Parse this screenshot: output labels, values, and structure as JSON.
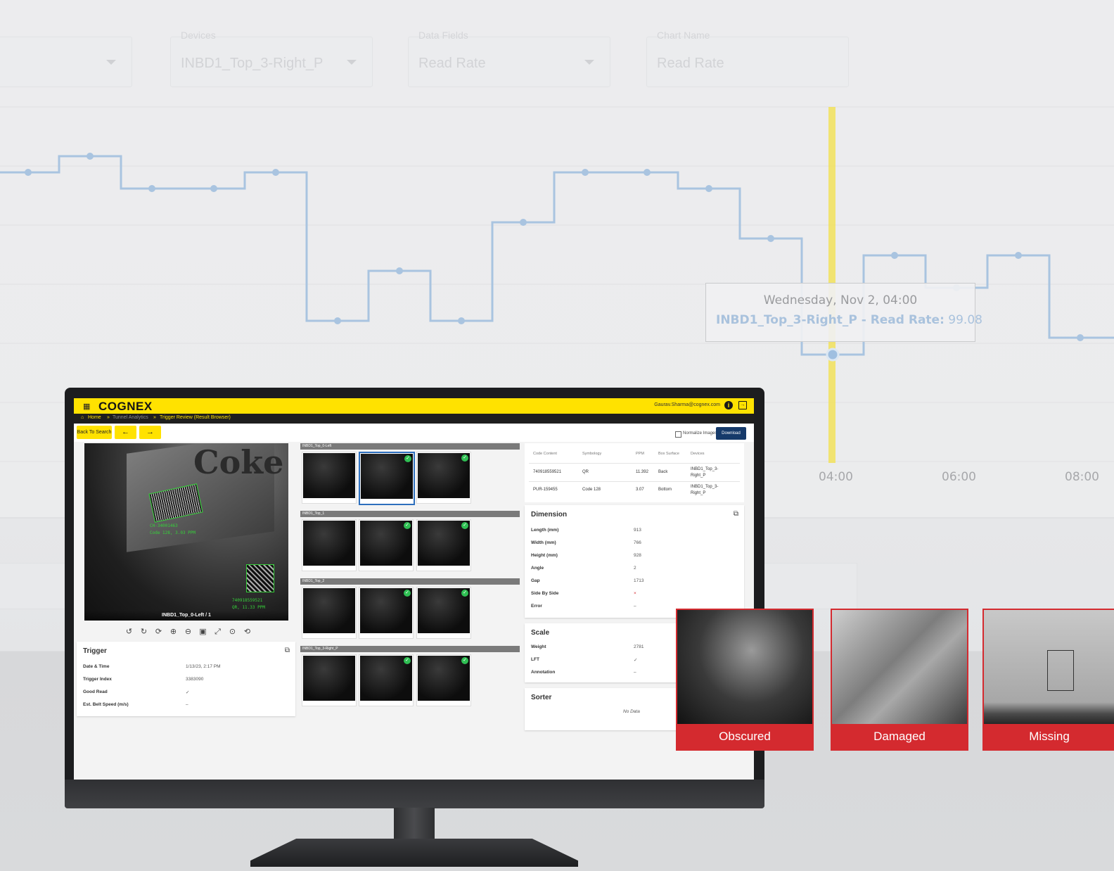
{
  "background": {
    "filters": [
      {
        "label": "",
        "value": ""
      },
      {
        "label": "Devices",
        "value": "INBD1_Top_3-Right_P"
      },
      {
        "label": "Data Fields",
        "value": "Read Rate"
      },
      {
        "label": "Chart Name",
        "value": "Read Rate"
      }
    ],
    "tooltip": {
      "title": "Wednesday, Nov 2, 04:00",
      "series": "INBD1_Top_3-Right_P - Read Rate:",
      "value": "99.08"
    },
    "x_ticks": [
      "04:00",
      "06:00",
      "08:00"
    ],
    "colors": {
      "line": "#a9c4e0",
      "highlight": "#f2e25a"
    }
  },
  "chart_data": {
    "type": "line",
    "step": true,
    "series": [
      {
        "name": "INBD1_Top_3-Right_P",
        "values": []
      }
    ],
    "highlight": {
      "x": "04:00",
      "label": "Wednesday, Nov 2, 04:00",
      "value": 99.08
    },
    "x_ticks": [
      "04:00",
      "06:00",
      "08:00"
    ],
    "ylabel": "Read Rate",
    "grid": true
  },
  "app": {
    "logo": "COGNEX",
    "user": "Gaurav.Sharma@cognex.com",
    "breadcrumb": {
      "home": "Home",
      "sep": "»",
      "level1": "Tunnel Analytics",
      "level2": "Trigger Review (Result Browser)"
    },
    "toolbar": {
      "back": "Back To Search",
      "prev": "←",
      "next": "→",
      "normalize": "Normalize Images",
      "download": "Download"
    },
    "main_image": {
      "caption": "INBD1_Top_0-Left / 1",
      "brand_text": "Coke",
      "read1": "CH-34001463",
      "read1_info": "Code 128, 3.03 PPM",
      "read2": "740918559521",
      "read2_info": "QR, 11.33 PPM"
    },
    "image_tools": [
      "↺",
      "↻",
      "⟳",
      "⊕",
      "⊖",
      "▣",
      "⤢",
      "⊙",
      "⟲"
    ],
    "trigger": {
      "title": "Trigger",
      "rows": [
        {
          "label": "Date & Time",
          "value": "1/13/23, 2:17 PM"
        },
        {
          "label": "Trigger Index",
          "value": "3383090"
        },
        {
          "label": "Good Read",
          "value": "✓"
        },
        {
          "label": "Est. Belt Speed (m/s)",
          "value": "–"
        }
      ]
    },
    "thumb_groups": [
      {
        "label": "INBD1_Top_0-Left"
      },
      {
        "label": "INBD1_Top_1"
      },
      {
        "label": "INBD1_Top_2"
      },
      {
        "label": "INBD1_Top_3-Right_P"
      }
    ],
    "reads_table": {
      "headers": [
        "Code Content",
        "Symbology",
        "PPM",
        "Box Surface",
        "Devices"
      ],
      "rows": [
        [
          "740918559521",
          "QR",
          "11.392",
          "Back",
          "INBD1_Top_3-Right_P"
        ],
        [
          "PUR-159455",
          "Code 128",
          "3.07",
          "Bottom",
          "INBD1_Top_3-Right_P"
        ]
      ]
    },
    "dimension": {
      "title": "Dimension",
      "rows": [
        {
          "label": "Length (mm)",
          "value": "913"
        },
        {
          "label": "Width (mm)",
          "value": "766"
        },
        {
          "label": "Height (mm)",
          "value": "928"
        },
        {
          "label": "Angle",
          "value": "2"
        },
        {
          "label": "Gap",
          "value": "1713"
        },
        {
          "label": "Side By Side",
          "value": "×"
        },
        {
          "label": "Error",
          "value": "–"
        }
      ]
    },
    "scale": {
      "title": "Scale",
      "rows": [
        {
          "label": "Weight",
          "value": "2781"
        },
        {
          "label": "LFT",
          "value": "✓"
        },
        {
          "label": "Annotation",
          "value": "–"
        }
      ]
    },
    "sorter": {
      "title": "Sorter",
      "empty": "No Data"
    }
  },
  "defects": [
    {
      "label": "Obscured"
    },
    {
      "label": "Damaged"
    },
    {
      "label": "Missing"
    }
  ]
}
